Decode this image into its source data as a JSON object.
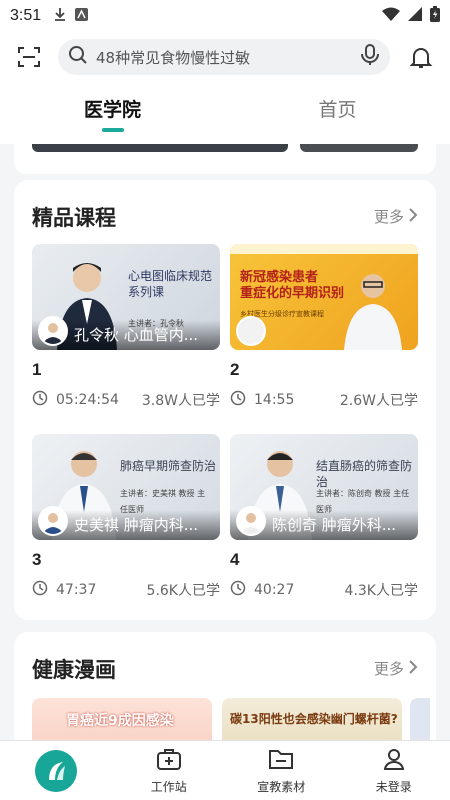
{
  "status": {
    "time": "3:51"
  },
  "search": {
    "placeholder": "48种常见食物慢性过敏"
  },
  "tabs": [
    {
      "label": "医学院",
      "active": true
    },
    {
      "label": "首页",
      "active": false
    }
  ],
  "courses_section": {
    "title": "精品课程",
    "more": "更多",
    "items": [
      {
        "index": "1",
        "duration": "05:24:54",
        "learners": "3.8W人已学",
        "speaker": "孔令秋 心血管内...",
        "thumb_title": "心电图临床规范\n系列课",
        "thumb_sub": "主讲者：孔令秋"
      },
      {
        "index": "2",
        "duration": "14:55",
        "learners": "2.6W人已学",
        "speaker": "",
        "thumb_title": "新冠感染患者\n重症化的早期识别",
        "thumb_sub": "乡村医生分级诊疗宣教课程"
      },
      {
        "index": "3",
        "duration": "47:37",
        "learners": "5.6K人已学",
        "speaker": "史美祺 肿瘤内科...",
        "thumb_title": "肺癌早期筛查防治",
        "thumb_sub": "主讲者：史美祺 教授 主任医师"
      },
      {
        "index": "4",
        "duration": "40:27",
        "learners": "4.3K人已学",
        "speaker": "陈创奇 肿瘤外科...",
        "thumb_title": "结直肠癌的筛查防治",
        "thumb_sub": "主讲者：陈创奇 教授 主任医师"
      }
    ]
  },
  "comics_section": {
    "title": "健康漫画",
    "more": "更多",
    "items": [
      {
        "title": "胃癌近9成因感染"
      },
      {
        "title": "碳13阳性也会感染幽门螺杆菌?"
      }
    ]
  },
  "bottom_nav": [
    {
      "label": "",
      "icon": "app-logo-icon"
    },
    {
      "label": "工作站",
      "icon": "medical-kit-icon"
    },
    {
      "label": "宣教素材",
      "icon": "folder-icon"
    },
    {
      "label": "未登录",
      "icon": "user-icon"
    }
  ],
  "colors": {
    "accent": "#1aa99a",
    "logo": "#17a697"
  }
}
